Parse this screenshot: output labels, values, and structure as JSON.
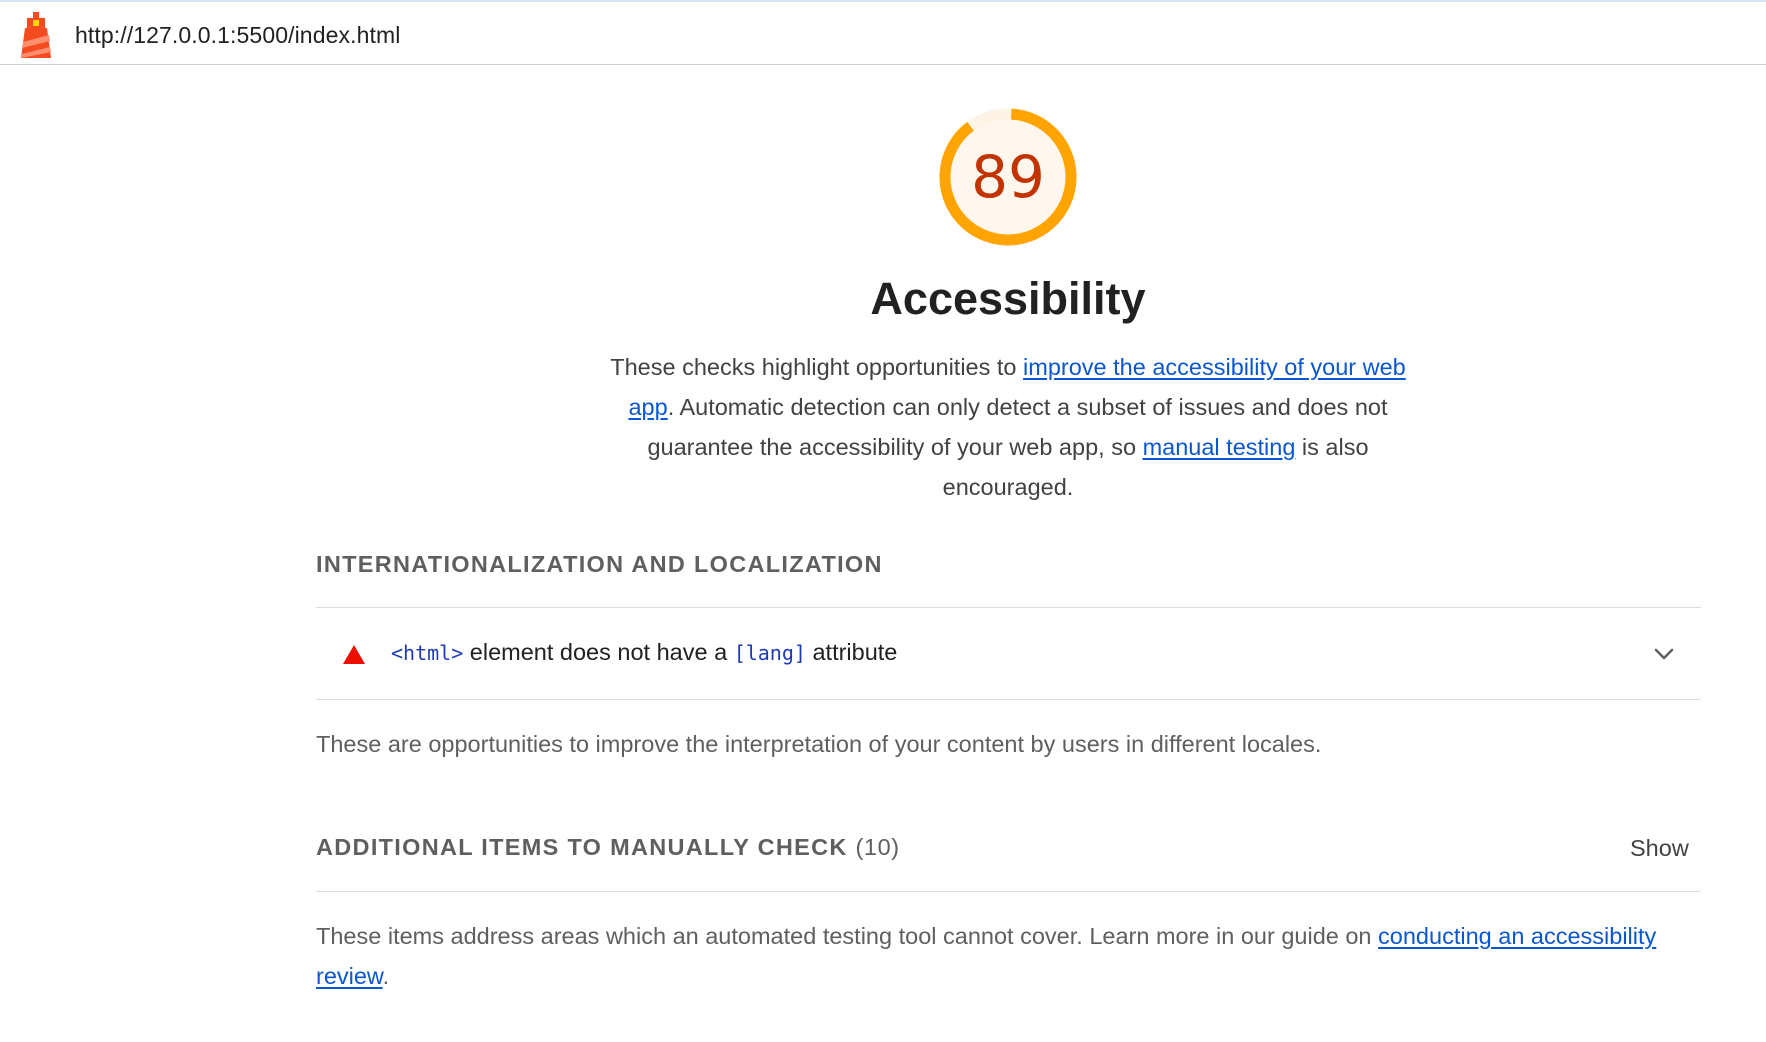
{
  "toolbar": {
    "url": "http://127.0.0.1:5500/index.html",
    "logo_icon": "lighthouse-icon"
  },
  "category": {
    "score": "89",
    "score_fraction": 0.89,
    "score_color": "#ffa400",
    "score_text_color": "#c33300",
    "title": "Accessibility",
    "description_parts": {
      "intro": "These checks highlight opportunities to ",
      "link1": "improve the accessibility of your web app",
      "middle": ". Automatic detection can only detect a subset of issues and does not guarantee the accessibility of your web app, so ",
      "link2": "manual testing",
      "outro": " is also encouraged."
    }
  },
  "groups": {
    "i18n": {
      "title": "Internationalization and Localization",
      "audit": {
        "icon": "fail-triangle-icon",
        "code1": "<html>",
        "text1": " element does not have a ",
        "code2": "[lang]",
        "text2": " attribute",
        "chevron_icon": "chevron-down-icon"
      },
      "description": "These are opportunities to improve the interpretation of your content by users in different locales."
    },
    "manual": {
      "title": "Additional items to manually check",
      "count": "(10)",
      "show_label": "Show",
      "description_intro": "These items address areas which an automated testing tool cannot cover. Learn more in our guide on ",
      "description_link": "conducting an accessibility review",
      "description_outro": "."
    }
  }
}
